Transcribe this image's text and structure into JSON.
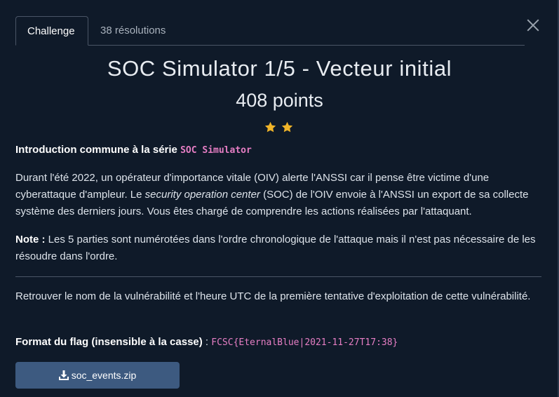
{
  "tabs": [
    {
      "label": "Challenge",
      "active": true
    },
    {
      "label": "38 résolutions",
      "active": false
    }
  ],
  "challenge": {
    "title": "SOC Simulator 1/5 - Vecteur initial",
    "points": "408 points",
    "stars": 2,
    "star_color": "#f0b429"
  },
  "intro": {
    "bold": "Introduction commune à la série ",
    "code": "SOC Simulator"
  },
  "paragraph1": {
    "before": "Durant l'été 2022, un opérateur d'importance vitale (OIV) alerte l'ANSSI car il pense être victime d'une cyberattaque d'ampleur. Le ",
    "italic": "security operation center",
    "after": " (SOC) de l'OIV envoie à l'ANSSI un export de sa collecte système des derniers jours. Vous êtes chargé de comprendre les actions réalisées par l'attaquant."
  },
  "note": {
    "label": "Note :",
    "text": " Les 5 parties sont numérotées dans l'ordre chronologique de l'attaque mais il n'est pas nécessaire de les résoudre dans l'ordre."
  },
  "task": {
    "text": "Retrouver le nom de la vulnérabilité et l'heure UTC de la première tentative d'exploitation de cette vulnérabilité."
  },
  "flag_format": {
    "label": "Format du flag (insensible à la casse)",
    "separator": " : ",
    "example": "FCSC{EternalBlue|2021-11-27T17:38}"
  },
  "download": {
    "label": "soc_events.zip",
    "icon": "download-icon"
  },
  "colors": {
    "background": "#0f1a29",
    "accent_code": "#e67ec4",
    "button": "#3d5a80"
  }
}
